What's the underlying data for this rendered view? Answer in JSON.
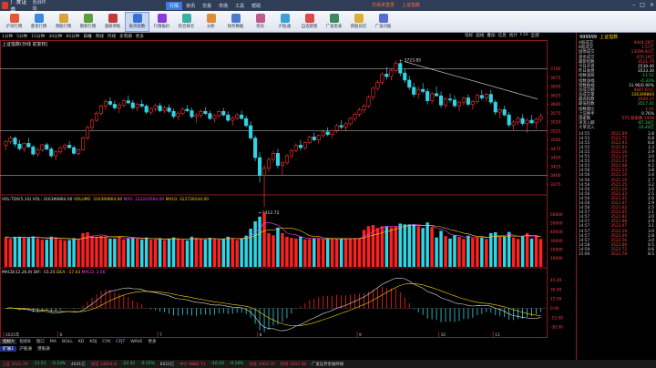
{
  "app": {
    "logo_text": "广发证券",
    "subtitle": "金融终端",
    "menu": [
      "行情",
      "资讯",
      "交易",
      "市场",
      "工具",
      "帮助"
    ],
    "menu_active": 0,
    "title_right": [
      "交易未登录",
      "上证指数"
    ]
  },
  "toolbar": [
    {
      "label": "沪深行情",
      "color": "#e05a3a"
    },
    {
      "label": "基金行情",
      "color": "#3a8be0"
    },
    {
      "label": "港股行情",
      "color": "#d9a23a"
    },
    {
      "label": "期权行情",
      "color": "#5aa03a"
    },
    {
      "label": "涨跌停板",
      "color": "#c03a3a"
    },
    {
      "label": "板块指数",
      "color": "#3a6ed9"
    },
    {
      "label": "行情报价",
      "color": "#8a3ad9"
    },
    {
      "label": "综合排名",
      "color": "#3ab0a0"
    },
    {
      "label": "分析",
      "color": "#e08a3a"
    },
    {
      "label": "财务数据",
      "color": "#4a7ad0"
    },
    {
      "label": "资讯",
      "color": "#c05a8a"
    },
    {
      "label": "沪股通",
      "color": "#3aa0d9"
    },
    {
      "label": "自选管理",
      "color": "#d94a4a"
    },
    {
      "label": "广发金拿",
      "color": "#3a8a5a"
    },
    {
      "label": "新股日历",
      "color": "#d9b03a"
    },
    {
      "label": "广发问股",
      "color": "#5a6ad9"
    }
  ],
  "toolbar_selected": 5,
  "subtabs": [
    "1分钟",
    "5分钟",
    "15分钟",
    "30分钟",
    "60分钟",
    "日线",
    "周线",
    "月线",
    "多周期",
    "更多"
  ],
  "subtab_active": 5,
  "right_tools": [
    "指标",
    "画线",
    "叠加",
    "信息",
    "统计",
    "F10",
    "全部"
  ],
  "chart_title": "上证指数(日线 前复权)",
  "price_chart": {
    "ymax": 3750,
    "ymin": 3350,
    "yticks": [
      "3700",
      "3675",
      "3650",
      "3625",
      "3600",
      "3575",
      "3550",
      "3525",
      "3500",
      "3475",
      "3450",
      "3425",
      "3400",
      "3375"
    ],
    "high_label": "3723.85",
    "low_label": "3312.72"
  },
  "chart_data": [
    {
      "type": "candlestick",
      "ylim": [
        3350,
        3750
      ],
      "note_high": "3723.85",
      "note_low": "3312.72",
      "x_month_labels": [
        "2021年",
        "6",
        "7",
        "8",
        "9",
        "10",
        "11"
      ],
      "candles": [
        [
          3485,
          3500,
          3470,
          3495
        ],
        [
          3495,
          3512,
          3488,
          3505
        ],
        [
          3505,
          3510,
          3480,
          3488
        ],
        [
          3488,
          3500,
          3470,
          3475
        ],
        [
          3475,
          3492,
          3465,
          3490
        ],
        [
          3490,
          3505,
          3478,
          3480
        ],
        [
          3480,
          3486,
          3455,
          3460
        ],
        [
          3460,
          3478,
          3452,
          3472
        ],
        [
          3472,
          3488,
          3466,
          3486
        ],
        [
          3486,
          3492,
          3470,
          3474
        ],
        [
          3474,
          3480,
          3450,
          3455
        ],
        [
          3455,
          3470,
          3442,
          3466
        ],
        [
          3466,
          3482,
          3460,
          3478
        ],
        [
          3478,
          3490,
          3470,
          3485
        ],
        [
          3485,
          3496,
          3475,
          3478
        ],
        [
          3478,
          3484,
          3458,
          3462
        ],
        [
          3462,
          3476,
          3455,
          3472
        ],
        [
          3472,
          3510,
          3470,
          3505
        ],
        [
          3505,
          3540,
          3498,
          3535
        ],
        [
          3535,
          3560,
          3528,
          3555
        ],
        [
          3555,
          3580,
          3550,
          3575
        ],
        [
          3575,
          3600,
          3568,
          3595
        ],
        [
          3595,
          3615,
          3585,
          3608
        ],
        [
          3608,
          3620,
          3595,
          3600
        ],
        [
          3600,
          3610,
          3585,
          3590
        ],
        [
          3590,
          3605,
          3575,
          3598
        ],
        [
          3598,
          3615,
          3592,
          3610
        ],
        [
          3610,
          3625,
          3600,
          3604
        ],
        [
          3604,
          3612,
          3585,
          3590
        ],
        [
          3590,
          3605,
          3580,
          3600
        ],
        [
          3600,
          3612,
          3590,
          3595
        ],
        [
          3595,
          3600,
          3572,
          3578
        ],
        [
          3578,
          3592,
          3570,
          3588
        ],
        [
          3588,
          3602,
          3580,
          3596
        ],
        [
          3596,
          3604,
          3578,
          3582
        ],
        [
          3582,
          3596,
          3575,
          3590
        ],
        [
          3590,
          3600,
          3575,
          3580
        ],
        [
          3580,
          3588,
          3560,
          3566
        ],
        [
          3566,
          3580,
          3556,
          3575
        ],
        [
          3575,
          3592,
          3570,
          3586
        ],
        [
          3586,
          3598,
          3578,
          3582
        ],
        [
          3582,
          3590,
          3560,
          3565
        ],
        [
          3565,
          3575,
          3548,
          3570
        ],
        [
          3570,
          3586,
          3562,
          3580
        ],
        [
          3580,
          3592,
          3570,
          3574
        ],
        [
          3574,
          3582,
          3555,
          3560
        ],
        [
          3560,
          3572,
          3548,
          3568
        ],
        [
          3568,
          3584,
          3562,
          3580
        ],
        [
          3580,
          3590,
          3566,
          3570
        ],
        [
          3570,
          3580,
          3550,
          3555
        ],
        [
          3555,
          3566,
          3540,
          3562
        ],
        [
          3562,
          3576,
          3555,
          3570
        ],
        [
          3570,
          3582,
          3556,
          3560
        ],
        [
          3560,
          3568,
          3535,
          3540
        ],
        [
          3540,
          3552,
          3500,
          3505
        ],
        [
          3505,
          3512,
          3440,
          3450
        ],
        [
          3450,
          3465,
          3380,
          3400
        ],
        [
          3400,
          3430,
          3312,
          3420
        ],
        [
          3420,
          3450,
          3410,
          3445
        ],
        [
          3445,
          3470,
          3436,
          3462
        ],
        [
          3462,
          3475,
          3420,
          3428
        ],
        [
          3428,
          3440,
          3400,
          3435
        ],
        [
          3435,
          3460,
          3430,
          3455
        ],
        [
          3455,
          3475,
          3448,
          3470
        ],
        [
          3470,
          3490,
          3465,
          3485
        ],
        [
          3485,
          3500,
          3470,
          3478
        ],
        [
          3478,
          3495,
          3472,
          3492
        ],
        [
          3492,
          3512,
          3488,
          3508
        ],
        [
          3508,
          3520,
          3495,
          3500
        ],
        [
          3500,
          3515,
          3490,
          3512
        ],
        [
          3512,
          3528,
          3505,
          3522
        ],
        [
          3522,
          3535,
          3510,
          3515
        ],
        [
          3515,
          3530,
          3505,
          3526
        ],
        [
          3526,
          3545,
          3520,
          3540
        ],
        [
          3540,
          3555,
          3530,
          3536
        ],
        [
          3536,
          3550,
          3525,
          3545
        ],
        [
          3545,
          3565,
          3540,
          3560
        ],
        [
          3560,
          3578,
          3552,
          3572
        ],
        [
          3572,
          3590,
          3565,
          3584
        ],
        [
          3584,
          3600,
          3575,
          3595
        ],
        [
          3595,
          3625,
          3590,
          3620
        ],
        [
          3620,
          3650,
          3612,
          3645
        ],
        [
          3645,
          3668,
          3638,
          3662
        ],
        [
          3662,
          3690,
          3655,
          3685
        ],
        [
          3685,
          3705,
          3670,
          3678
        ],
        [
          3678,
          3700,
          3668,
          3695
        ],
        [
          3695,
          3723,
          3688,
          3715
        ],
        [
          3715,
          3722,
          3680,
          3688
        ],
        [
          3688,
          3700,
          3660,
          3668
        ],
        [
          3668,
          3680,
          3640,
          3648
        ],
        [
          3648,
          3660,
          3620,
          3628
        ],
        [
          3628,
          3650,
          3615,
          3642
        ],
        [
          3642,
          3660,
          3630,
          3636
        ],
        [
          3636,
          3645,
          3600,
          3610
        ],
        [
          3610,
          3635,
          3602,
          3630
        ],
        [
          3630,
          3650,
          3622,
          3624
        ],
        [
          3624,
          3636,
          3590,
          3598
        ],
        [
          3598,
          3620,
          3588,
          3615
        ],
        [
          3615,
          3630,
          3605,
          3612
        ],
        [
          3612,
          3625,
          3590,
          3596
        ],
        [
          3596,
          3610,
          3580,
          3606
        ],
        [
          3606,
          3622,
          3598,
          3618
        ],
        [
          3618,
          3628,
          3595,
          3600
        ],
        [
          3600,
          3612,
          3585,
          3608
        ],
        [
          3608,
          3630,
          3602,
          3625
        ],
        [
          3625,
          3640,
          3612,
          3618
        ],
        [
          3618,
          3632,
          3608,
          3628
        ],
        [
          3628,
          3640,
          3600,
          3606
        ],
        [
          3606,
          3612,
          3570,
          3578
        ],
        [
          3578,
          3590,
          3560,
          3585
        ],
        [
          3585,
          3596,
          3566,
          3570
        ],
        [
          3570,
          3578,
          3535,
          3542
        ],
        [
          3542,
          3556,
          3528,
          3550
        ],
        [
          3550,
          3566,
          3542,
          3560
        ],
        [
          3560,
          3572,
          3540,
          3546
        ],
        [
          3546,
          3560,
          3520,
          3555
        ],
        [
          3555,
          3570,
          3545,
          3548
        ],
        [
          3548,
          3562,
          3530,
          3558
        ],
        [
          3558,
          3574,
          3550,
          3566
        ]
      ]
    },
    {
      "type": "bar",
      "title": "VOL-TDX(5,10)",
      "labels": {
        "vol": "VOL: 316399864.00",
        "vol_label": "VOLUME: 316399864.00",
        "ma5": "MA5: 312243504.00",
        "ma10": "MA10: 312730144.00"
      },
      "yticks": [
        "60000",
        "50000",
        "40000",
        "30000",
        "20000",
        "10000"
      ],
      "ylim": [
        0,
        70000
      ]
    },
    {
      "type": "line",
      "title": "MACD(12,26,9)",
      "labels": {
        "dif": "DIF: -15.25",
        "dea": "DEA: -17.03",
        "macd": "MACD: 3.56"
      },
      "yticks": [
        "45.00",
        "30.00",
        "15.00",
        "0.00",
        "-15.00",
        "-30.00"
      ],
      "ylim": [
        -40,
        50
      ]
    }
  ],
  "bottom_tabs": [
    "指标A",
    "指标B",
    "窗口",
    "MA",
    "BOLL",
    "KD",
    "KDJ",
    "CYK",
    "CFJT",
    "WAVE",
    "更多"
  ],
  "bottom_tab_active": 0,
  "bottom_tabs2": [
    "扩展1",
    "沪股通",
    "港股通"
  ],
  "right_panel": {
    "code": "999999",
    "name": "上证指数",
    "stats": [
      {
        "k": "A股成交",
        "v": "4444.26亿",
        "c": "v"
      },
      {
        "k": "B股成交",
        "v": "1.57亿",
        "c": "v"
      },
      {
        "k": "国债成交",
        "v": "13596.81亿",
        "c": "v"
      },
      {
        "k": "基金成交",
        "v": "470.19亿",
        "c": "v"
      },
      {
        "k": "最新指数",
        "v": "3521.79",
        "c": "v"
      },
      {
        "k": "今日开盘",
        "v": "3538.46",
        "c": "w"
      },
      {
        "k": "昨日收盘",
        "v": "3533.30",
        "c": "w"
      },
      {
        "k": "指数涨跌",
        "v": "-11.51",
        "c": "g"
      },
      {
        "k": "指数涨幅",
        "v": "-0.33%",
        "c": "g"
      },
      {
        "k": "指数振幅",
        "v": "31.96/0.90%",
        "c": "w"
      },
      {
        "k": "总成交额",
        "v": "4687.61亿",
        "c": "v"
      },
      {
        "k": "总成交量",
        "v": "316399864",
        "c": "y"
      },
      {
        "k": "最高指数",
        "v": "3549.37",
        "c": "v"
      },
      {
        "k": "最低指数",
        "v": "3517.41",
        "c": "g"
      },
      {
        "k": "指数量比",
        "v": "1.01",
        "c": "v"
      },
      {
        "k": "上证换手",
        "v": "0.76%",
        "c": "w"
      },
      {
        "k": "涨家数",
        "v": "575 跌家数 1408",
        "c": "v"
      },
      {
        "k": "净流入额",
        "v": "-87.34亿",
        "c": "g"
      },
      {
        "k": "大单流入",
        "v": "-16.44亿",
        "c": "g"
      }
    ],
    "ticks": [
      [
        "14:55",
        "3521.69",
        "2.8"
      ],
      [
        "14:55",
        "3521.75",
        "6.8"
      ],
      [
        "14:55",
        "3521.93",
        "8.8"
      ],
      [
        "14:55",
        "3521.93",
        "3.3"
      ],
      [
        "14:55",
        "3521.16",
        "2.9"
      ],
      [
        "14:55",
        "3521.14",
        "3.0"
      ],
      [
        "14:55",
        "3521.23",
        "3.4"
      ],
      [
        "14:55",
        "3521.08",
        "4.2"
      ],
      [
        "14:56",
        "3521.13",
        "3.8"
      ],
      [
        "14:56",
        "3521.10",
        "3.4"
      ],
      [
        "14:56",
        "3521.16",
        "2.7"
      ],
      [
        "14:56",
        "3521.25",
        "3.2"
      ],
      [
        "14:56",
        "3521.29",
        "3.0"
      ],
      [
        "14:56",
        "3521.33",
        "2.5"
      ],
      [
        "14:56",
        "3521.35",
        "2.6"
      ],
      [
        "14:56",
        "3521.47",
        "2.9"
      ],
      [
        "14:56",
        "3521.62",
        "2.5"
      ],
      [
        "14:57",
        "3521.65",
        "3.1"
      ],
      [
        "14:57",
        "3521.82",
        "3.0"
      ],
      [
        "14:57",
        "3521.88",
        "2.9"
      ],
      [
        "14:57",
        "3522.07",
        "3.1"
      ],
      [
        "14:57",
        "3522.29",
        "3.0"
      ],
      [
        "14:57",
        "3522.49",
        "2.8"
      ],
      [
        "14:57",
        "3522.56",
        "3.0"
      ],
      [
        "14:58",
        "3522.66",
        "0.5"
      ],
      [
        "14:59",
        "3522.72",
        "0.6"
      ],
      [
        "15:00",
        "3521.79",
        "8.5"
      ]
    ]
  },
  "statusbar": [
    {
      "t": "上证 3521.79",
      "c": "red"
    },
    {
      "t": "-11.51",
      "c": "green"
    },
    {
      "t": "-0.33%",
      "c": "green"
    },
    {
      "t": "4441亿",
      "c": ""
    },
    {
      "t": "深证 14614.8",
      "c": "red"
    },
    {
      "t": "-22.42",
      "c": "green"
    },
    {
      "t": "-0.15%",
      "c": "green"
    },
    {
      "t": "6022亿",
      "c": ""
    },
    {
      "t": "中小 9882.71",
      "c": "red"
    },
    {
      "t": "-16.18",
      "c": "green"
    },
    {
      "t": "-0.16%",
      "c": "green"
    },
    {
      "t": "创业 3303.70",
      "c": "red"
    },
    {
      "t": "科创 1502.58",
      "c": "red"
    },
    {
      "t": "广发证券金融终端",
      "c": ""
    }
  ]
}
